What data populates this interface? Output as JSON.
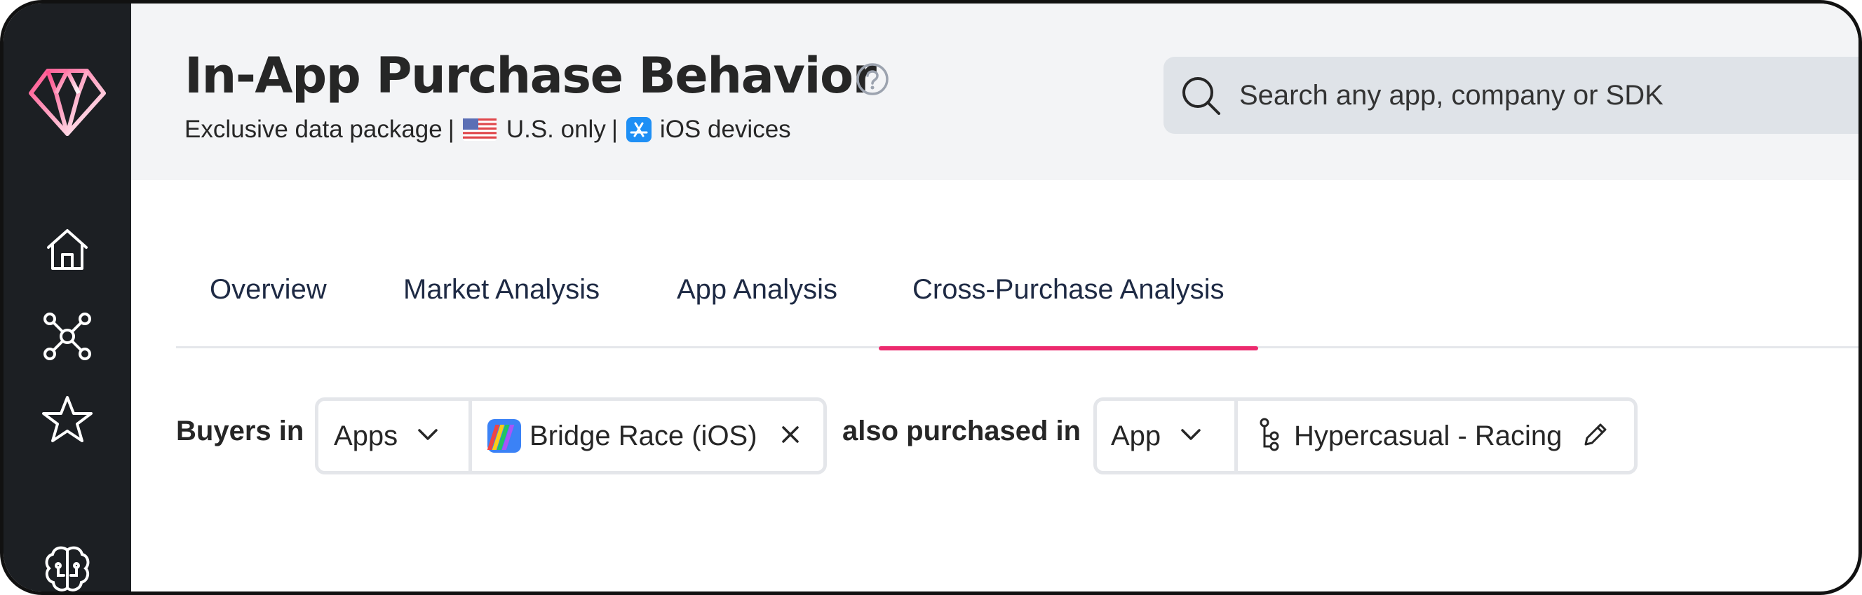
{
  "sidebar": {
    "items": [
      {
        "name": "logo",
        "icon": "diamond-icon"
      },
      {
        "name": "home",
        "icon": "home-icon"
      },
      {
        "name": "network",
        "icon": "network-icon"
      },
      {
        "name": "favorites",
        "icon": "star-icon"
      },
      {
        "name": "ai",
        "icon": "brain-icon"
      }
    ]
  },
  "header": {
    "title": "In-App Purchase Behavior",
    "subtitle": {
      "package": "Exclusive data package",
      "separator": "|",
      "region": "U.S. only",
      "devices": "iOS devices"
    },
    "search_placeholder": "Search any app, company or SDK"
  },
  "tabs": [
    {
      "label": "Overview",
      "active": false
    },
    {
      "label": "Market Analysis",
      "active": false
    },
    {
      "label": "App Analysis",
      "active": false
    },
    {
      "label": "Cross-Purchase Analysis",
      "active": true
    }
  ],
  "filters": {
    "buyers_label": "Buyers in",
    "buyers_type": "Apps",
    "buyers_app": "Bridge Race (iOS)",
    "also_label": "also purchased in",
    "target_type": "App",
    "target_value": "Hypercasual - Racing"
  },
  "colors": {
    "accent": "#ec2a6e",
    "sidebar": "#1c1f23",
    "header_bg": "#f3f4f6"
  }
}
